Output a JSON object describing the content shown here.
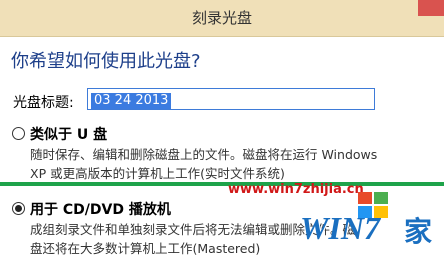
{
  "window": {
    "title": "刻录光盘"
  },
  "heading": "你希望如何使用此光盘?",
  "disc_title": {
    "label": "光盘标题:",
    "value": "03 24 2013"
  },
  "options": [
    {
      "title": "类似于 U 盘",
      "checked": false,
      "desc_line1": "随时保存、编辑和删除磁盘上的文件。磁盘将在运行 Windows",
      "desc_line2": "XP 或更高版本的计算机上工作(实时文件系统)"
    },
    {
      "title": "用于 CD/DVD 播放机",
      "checked": true,
      "desc_line1": "成组刻录文件和单独刻录文件后将无法编辑或删除文件。磁",
      "desc_line2": "盘还将在大多数计算机上工作(Mastered)"
    }
  ],
  "watermark": {
    "url": "www.win7zhijia.cn",
    "logo_text": "WIN7",
    "logo_suffix": "家"
  }
}
